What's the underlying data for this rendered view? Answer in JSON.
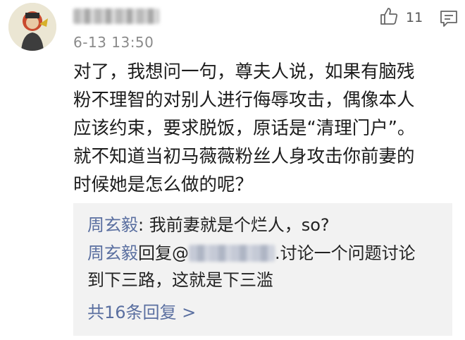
{
  "comment": {
    "time": "6-13 13:50",
    "like_count": "11",
    "lines": [
      "对了，我想问一句，尊夫人说，如果有脑残",
      "粉不理智的对别人进行侮辱攻击，偶像本人",
      "应该约束，要求脱饭，原话是“清理门户”。",
      "就不知道当初马薇薇粉丝人身攻击你前妻的",
      "时候她是怎么做的呢？"
    ]
  },
  "replies": {
    "reply1": {
      "name": "周玄毅",
      "text": ": 我前妻就是个烂人，so?"
    },
    "reply2": {
      "name": "周玄毅",
      "action": "回复@",
      "text_line1": ".讨论一个问题讨论",
      "text_line2": "到下三路，这就是下三滥"
    },
    "more_label": "共16条回复 >"
  },
  "icons": {
    "like": "thumbs-up-icon",
    "reply": "comment-reply-icon"
  },
  "colors": {
    "link": "#5a6fa0",
    "reply_background": "#f2f2f2",
    "timestamp": "#8a8a8a"
  }
}
